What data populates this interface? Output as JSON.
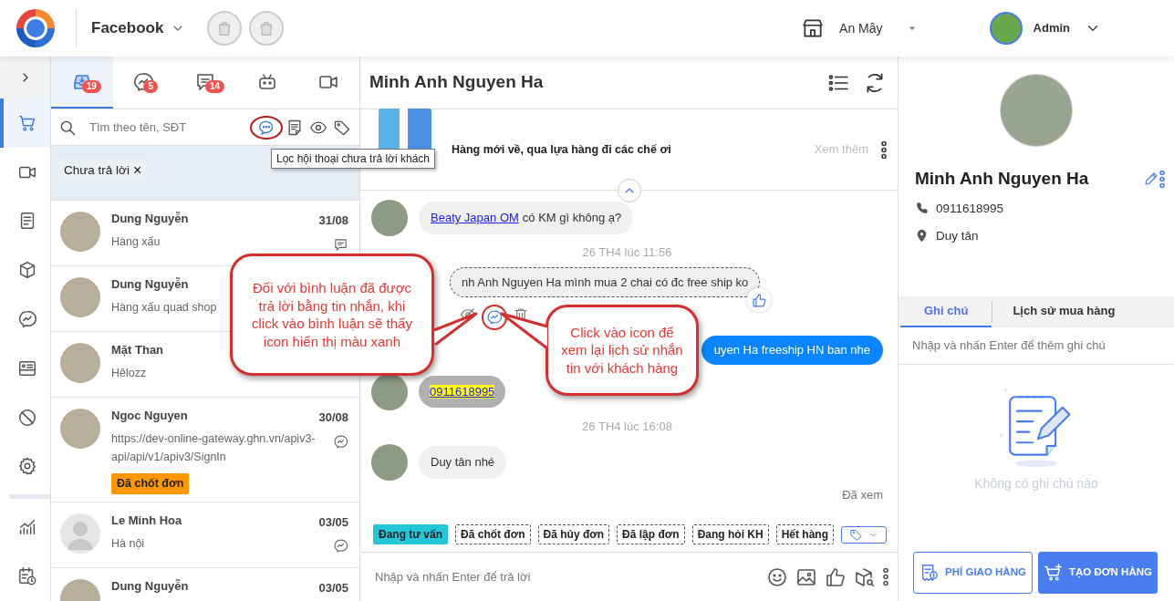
{
  "header": {
    "channel": "Facebook",
    "store": "An Mây",
    "user": "Admin"
  },
  "rail": [
    {
      "kind": "cart",
      "selected": true
    },
    {
      "kind": "video",
      "selected": false
    },
    {
      "kind": "note",
      "selected": false
    },
    {
      "kind": "box",
      "selected": false
    },
    {
      "kind": "messenger",
      "selected": false
    },
    {
      "kind": "card",
      "selected": false
    },
    {
      "kind": "block",
      "selected": false
    },
    {
      "kind": "gear",
      "selected": false
    },
    {
      "kind": "chart",
      "selected": false
    },
    {
      "kind": "schedule",
      "selected": false
    }
  ],
  "conversation_tabs": [
    {
      "kind": "inbox",
      "badge": "19",
      "selected": true
    },
    {
      "kind": "messenger",
      "badge": "5",
      "selected": false
    },
    {
      "kind": "comment",
      "badge": "14",
      "selected": false
    },
    {
      "kind": "bot",
      "selected": false
    },
    {
      "kind": "video",
      "selected": false
    }
  ],
  "search": {
    "placeholder": "Tìm theo tên, SĐT",
    "tooltip": "Lọc hội thoại chưa trả lời khách",
    "actions": [
      {
        "kind": "unreplied",
        "highlighted": true
      },
      {
        "kind": "document",
        "highlighted": false
      },
      {
        "kind": "eye",
        "highlighted": false
      },
      {
        "kind": "tag",
        "highlighted": false
      }
    ]
  },
  "filter_chips": [
    {
      "label": "Chưa trả lời",
      "remove": "×"
    }
  ],
  "conversations": [
    {
      "name": "Dung Nguyễn",
      "preview": "Hàng xấu",
      "date": "31/08",
      "kind": "comment",
      "has_photo": true
    },
    {
      "name": "Dung Nguyễn",
      "preview": "Hàng xấu quad shop",
      "has_photo": true
    },
    {
      "name": "Mặt Than",
      "preview": "Hêlozz",
      "has_photo": true
    },
    {
      "name": "Ngoc Nguyen",
      "preview": "https://dev-online-gateway.ghn.vn/apiv3-api/api/v1/apiv3/SignIn",
      "date": "30/08",
      "kind": "messenger",
      "has_photo": true,
      "tag": {
        "label": "Đã chốt đơn",
        "color": "#ff9800"
      }
    },
    {
      "name": "Le Minh Hoa",
      "preview": "Hà nội",
      "date": "03/05",
      "kind": "messenger",
      "has_photo": false
    },
    {
      "name": "Dung Nguyễn",
      "date": "03/05",
      "has_photo": true
    }
  ],
  "chat": {
    "title": "Minh Anh Nguyen Ha",
    "post": {
      "text": "Hàng mới về, qua lựa hàng đi các chế ơi",
      "more": "Xem thêm"
    },
    "messages": [
      {
        "kind": "incoming",
        "mention": "Beaty Japan OM",
        "text": "có KM gì không ạ?"
      },
      {
        "kind": "time",
        "text": "26 TH4 lúc 11:56"
      },
      {
        "kind": "comment",
        "text": "nh Anh Nguyen Ha mình mua 2 chai có đc free ship ko",
        "actions": [
          {
            "kind": "hide",
            "active": false,
            "highlighted": false
          },
          {
            "kind": "messenger",
            "active": true,
            "highlighted": true
          },
          {
            "kind": "delete",
            "active": false,
            "highlighted": false
          }
        ]
      },
      {
        "kind": "outgoing",
        "text": "uyen Ha freeship HN ban nhe"
      },
      {
        "kind": "phone",
        "text": "0911618995"
      },
      {
        "kind": "time",
        "text": "26 TH4 lúc 16:08"
      },
      {
        "kind": "incoming",
        "text": "Duy tân nhé"
      },
      {
        "kind": "seen",
        "text": "Đã xem"
      }
    ],
    "tags": [
      {
        "label": "Đang tư vấn",
        "selected": true
      },
      {
        "label": "Đã chốt đơn",
        "selected": false
      },
      {
        "label": "Đã hủy đơn",
        "selected": false
      },
      {
        "label": "Đã lập đơn",
        "selected": false
      },
      {
        "label": "Đang hỏi KH",
        "selected": false
      },
      {
        "label": "Hết hàng",
        "selected": false
      }
    ],
    "reply_placeholder": "Nhập và nhấn Enter để trả lời"
  },
  "customer": {
    "name": "Minh Anh Nguyen Ha",
    "phone": "0911618995",
    "address": "Duy tân",
    "tabs": [
      {
        "label": "Ghi chú",
        "selected": true
      },
      {
        "label": "Lịch sử mua hàng",
        "selected": false
      }
    ],
    "note_placeholder": "Nhập và nhấn Enter để thêm ghi chú",
    "empty": "Không có ghi chú nào",
    "buttons": [
      {
        "kind": "shipping",
        "label": "PHÍ GIAO HÀNG"
      },
      {
        "kind": "order",
        "label": "TẠO ĐƠN HÀNG"
      }
    ]
  },
  "callouts": [
    "Đối với bình luận đã được trả lời bằng tin nhắn, khi click vào bình luận sẽ thấy icon hiển thị màu xanh",
    "Click vào icon để xem lại lịch sử nhắn tin với khách hàng"
  ]
}
